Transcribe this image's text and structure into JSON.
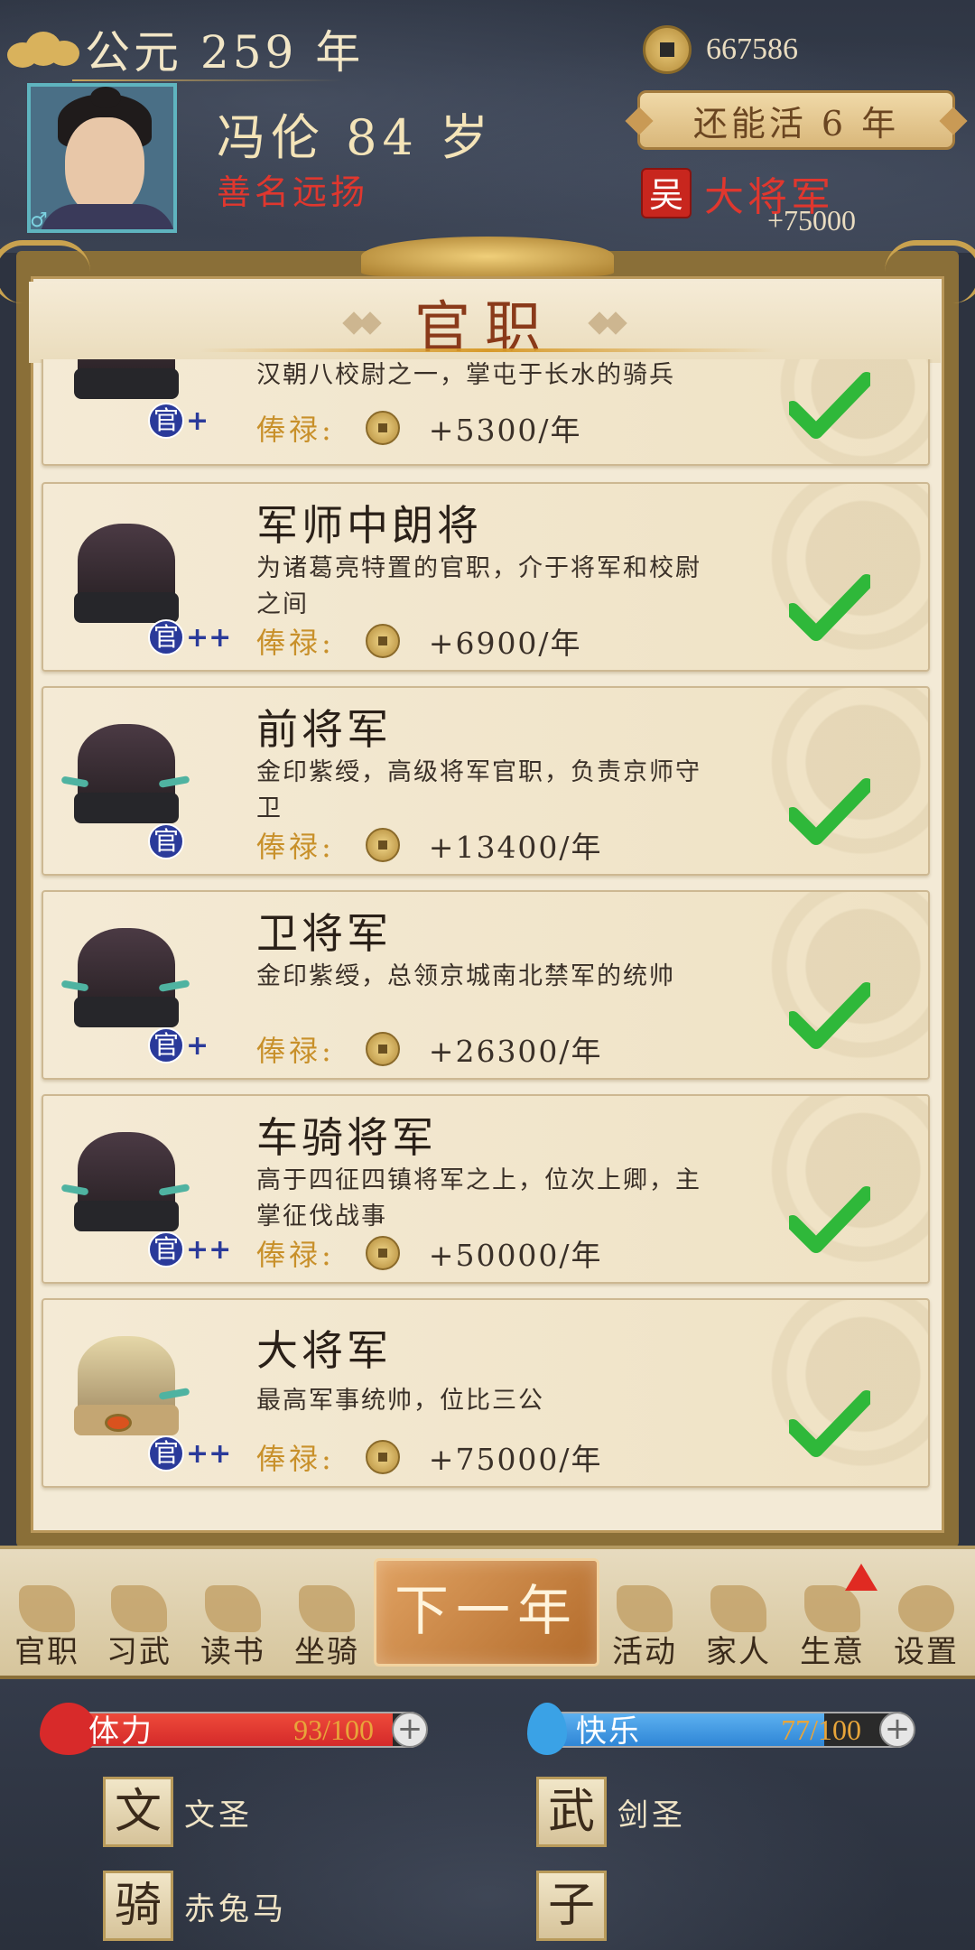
{
  "header": {
    "year": "公元 259 年",
    "name_age": "冯伦 84 岁",
    "reputation": "善名远扬",
    "coins": "667586",
    "life_remaining": "还能活 6 年",
    "kingdom": "吴",
    "current_rank": "大将军",
    "rank_salary": "+75000"
  },
  "panel": {
    "title": "官职",
    "items": [
      {
        "name": "",
        "desc": "汉朝八校尉之一，掌屯于长水的骑兵",
        "salary_label": "俸禄:",
        "salary": "+5300/年",
        "badge": "官",
        "badge_plus": "+",
        "completed": true
      },
      {
        "name": "军师中朗将",
        "desc": "为诸葛亮特置的官职，介于将军和校尉之间",
        "salary_label": "俸禄:",
        "salary": "+6900/年",
        "badge": "官",
        "badge_plus": "++",
        "completed": true
      },
      {
        "name": "前将军",
        "desc": "金印紫绶，高级将军官职，负责京师守卫",
        "salary_label": "俸禄:",
        "salary": "+13400/年",
        "badge": "官",
        "badge_plus": "",
        "completed": true
      },
      {
        "name": "卫将军",
        "desc": "金印紫绶，总领京城南北禁军的统帅",
        "salary_label": "俸禄:",
        "salary": "+26300/年",
        "badge": "官",
        "badge_plus": "+",
        "completed": true
      },
      {
        "name": "车骑将军",
        "desc": "高于四征四镇将军之上，位次上卿，主掌征伐战事",
        "salary_label": "俸禄:",
        "salary": "+50000/年",
        "badge": "官",
        "badge_plus": "++",
        "completed": true
      },
      {
        "name": "大将军",
        "desc": "最高军事统帅，位比三公",
        "salary_label": "俸禄:",
        "salary": "+75000/年",
        "badge": "官",
        "badge_plus": "++",
        "completed": true
      }
    ]
  },
  "nav": {
    "items": [
      "官职",
      "习武",
      "读书",
      "坐骑",
      "活动",
      "家人",
      "生意",
      "设置"
    ],
    "next_year": "下一年"
  },
  "status": {
    "stamina_label": "体力",
    "stamina_value": "93/100",
    "stamina_fraction": 0.93,
    "happiness_label": "快乐",
    "happiness_value": "77/100",
    "happiness_fraction": 0.77,
    "stats": [
      {
        "char": "文",
        "name": "文圣"
      },
      {
        "char": "武",
        "name": "剑圣"
      },
      {
        "char": "骑",
        "name": "赤兔马"
      },
      {
        "char": "子",
        "name": ""
      }
    ]
  },
  "colors": {
    "stamina": "#d42a2a",
    "happiness": "#2f86d6",
    "check": "#2fb83a"
  }
}
